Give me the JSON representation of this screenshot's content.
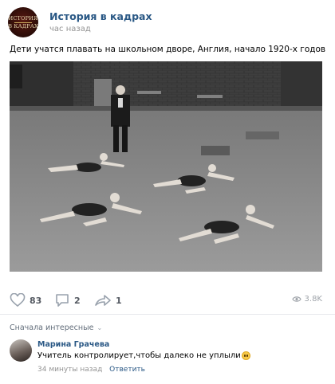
{
  "post": {
    "author": "История в кадрах",
    "time": "час назад",
    "avatar_lines": [
      "ИСТОРИЯ",
      "В КАДРАХ"
    ],
    "text": "Дети учатся плавать на школьном дворе, Англия, начало 1920-х годов",
    "photo_icon": "archival-photo-schoolyard"
  },
  "actions": {
    "likes": "83",
    "comments": "2",
    "shares": "1",
    "views": "3.8K"
  },
  "comments_section": {
    "sort_label": "Сначала интересные",
    "comment": {
      "author": "Марина Грачева",
      "text": "Учитель контролирует,чтобы далеко не уплыли",
      "time": "34 минуты назад",
      "reply_label": "Ответить"
    }
  },
  "colors": {
    "link": "#2a5885",
    "muted": "#939393",
    "icon": "#99a2ad"
  }
}
